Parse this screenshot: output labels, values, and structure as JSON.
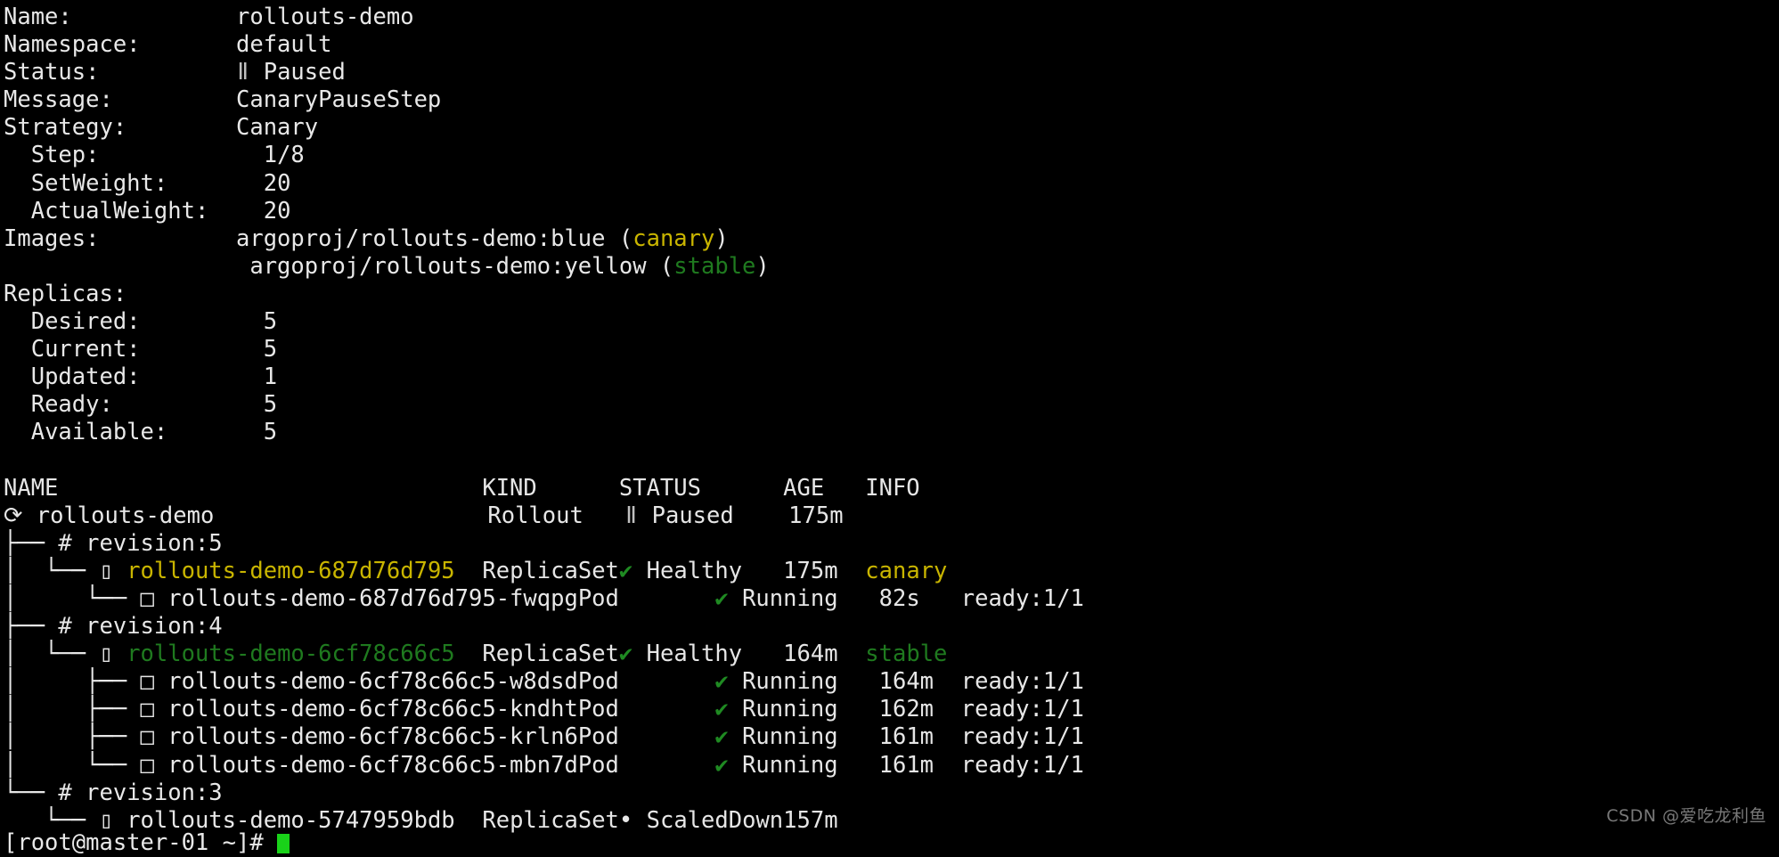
{
  "terminal": {
    "background": "#000000",
    "foreground": "#e8e8e8",
    "accent_yellow": "#c9b500",
    "accent_green": "#1f7a1f",
    "check_green": "#1f8a22",
    "cursor_color": "#19d219"
  },
  "summary": {
    "name_label": "Name:",
    "name_value": "rollouts-demo",
    "namespace_label": "Namespace:",
    "namespace_value": "default",
    "status_label": "Status:",
    "status_icon": "pause-icon",
    "status_icon_glyph": "ǁ",
    "status_value": "Paused",
    "message_label": "Message:",
    "message_value": "CanaryPauseStep",
    "strategy_label": "Strategy:",
    "strategy_value": "Canary",
    "step_label": "Step:",
    "step_value": "1/8",
    "setweight_label": "SetWeight:",
    "setweight_value": "20",
    "actualweight_label": "ActualWeight:",
    "actualweight_value": "20",
    "images_label": "Images:",
    "images": [
      {
        "image": "argoproj/rollouts-demo:blue",
        "tag": "canary",
        "tag_color": "#c9b500"
      },
      {
        "image": "argoproj/rollouts-demo:yellow",
        "tag": "stable",
        "tag_color": "#1f7a1f"
      }
    ],
    "replicas_label": "Replicas:",
    "replicas": [
      {
        "label": "Desired:",
        "value": "5"
      },
      {
        "label": "Current:",
        "value": "5"
      },
      {
        "label": "Updated:",
        "value": "1"
      },
      {
        "label": "Ready:",
        "value": "5"
      },
      {
        "label": "Available:",
        "value": "5"
      }
    ]
  },
  "table": {
    "headers": {
      "name": "NAME",
      "kind": "KIND",
      "status": "STATUS",
      "age": "AGE",
      "info": "INFO"
    },
    "rows": [
      {
        "tree": "",
        "icon": "rollout-icon",
        "icon_glyph": "⟳",
        "name": "rollouts-demo",
        "name_color": "#e8e8e8",
        "kind": "Rollout",
        "status_icon": "pause-icon",
        "status_icon_glyph": "ǁ",
        "status_icon_color": "#bfbfbf",
        "status": "Paused",
        "age": "175m",
        "info": "",
        "info_color": "#e8e8e8"
      },
      {
        "tree": "├──",
        "icon": "revision-icon",
        "icon_glyph": "#",
        "name": "revision:5",
        "name_color": "#e8e8e8",
        "kind": "",
        "status_icon": "",
        "status_icon_glyph": "",
        "status_icon_color": "",
        "status": "",
        "age": "",
        "info": "",
        "info_color": ""
      },
      {
        "tree": "│  └──",
        "icon": "replicaset-icon",
        "icon_glyph": "▯",
        "name": "rollouts-demo-687d76d795",
        "name_color": "#c9b500",
        "kind": "ReplicaSet",
        "status_icon": "check-icon",
        "status_icon_glyph": "✔",
        "status_icon_color": "#1f8a22",
        "status": "Healthy",
        "age": "175m",
        "info": "canary",
        "info_color": "#c9b500"
      },
      {
        "tree": "│     └──",
        "icon": "pod-icon",
        "icon_glyph": "□",
        "name": "rollouts-demo-687d76d795-fwqpg",
        "name_color": "#e8e8e8",
        "kind": "Pod",
        "status_icon": "check-icon",
        "status_icon_glyph": "✔",
        "status_icon_color": "#1f8a22",
        "status": "Running",
        "age": "82s",
        "info": "ready:1/1",
        "info_color": "#e8e8e8"
      },
      {
        "tree": "├──",
        "icon": "revision-icon",
        "icon_glyph": "#",
        "name": "revision:4",
        "name_color": "#e8e8e8",
        "kind": "",
        "status_icon": "",
        "status_icon_glyph": "",
        "status_icon_color": "",
        "status": "",
        "age": "",
        "info": "",
        "info_color": ""
      },
      {
        "tree": "│  └──",
        "icon": "replicaset-icon",
        "icon_glyph": "▯",
        "name": "rollouts-demo-6cf78c66c5",
        "name_color": "#1f7a1f",
        "kind": "ReplicaSet",
        "status_icon": "check-icon",
        "status_icon_glyph": "✔",
        "status_icon_color": "#1f8a22",
        "status": "Healthy",
        "age": "164m",
        "info": "stable",
        "info_color": "#1f7a1f"
      },
      {
        "tree": "│     ├──",
        "icon": "pod-icon",
        "icon_glyph": "□",
        "name": "rollouts-demo-6cf78c66c5-w8dsd",
        "name_color": "#e8e8e8",
        "kind": "Pod",
        "status_icon": "check-icon",
        "status_icon_glyph": "✔",
        "status_icon_color": "#1f8a22",
        "status": "Running",
        "age": "164m",
        "info": "ready:1/1",
        "info_color": "#e8e8e8"
      },
      {
        "tree": "│     ├──",
        "icon": "pod-icon",
        "icon_glyph": "□",
        "name": "rollouts-demo-6cf78c66c5-kndht",
        "name_color": "#e8e8e8",
        "kind": "Pod",
        "status_icon": "check-icon",
        "status_icon_glyph": "✔",
        "status_icon_color": "#1f8a22",
        "status": "Running",
        "age": "162m",
        "info": "ready:1/1",
        "info_color": "#e8e8e8"
      },
      {
        "tree": "│     ├──",
        "icon": "pod-icon",
        "icon_glyph": "□",
        "name": "rollouts-demo-6cf78c66c5-krln6",
        "name_color": "#e8e8e8",
        "kind": "Pod",
        "status_icon": "check-icon",
        "status_icon_glyph": "✔",
        "status_icon_color": "#1f8a22",
        "status": "Running",
        "age": "161m",
        "info": "ready:1/1",
        "info_color": "#e8e8e8"
      },
      {
        "tree": "│     └──",
        "icon": "pod-icon",
        "icon_glyph": "□",
        "name": "rollouts-demo-6cf78c66c5-mbn7d",
        "name_color": "#e8e8e8",
        "kind": "Pod",
        "status_icon": "check-icon",
        "status_icon_glyph": "✔",
        "status_icon_color": "#1f8a22",
        "status": "Running",
        "age": "161m",
        "info": "ready:1/1",
        "info_color": "#e8e8e8"
      },
      {
        "tree": "└──",
        "icon": "revision-icon",
        "icon_glyph": "#",
        "name": "revision:3",
        "name_color": "#e8e8e8",
        "kind": "",
        "status_icon": "",
        "status_icon_glyph": "",
        "status_icon_color": "",
        "status": "",
        "age": "",
        "info": "",
        "info_color": ""
      },
      {
        "tree": "   └──",
        "icon": "replicaset-icon",
        "icon_glyph": "▯",
        "name": "rollouts-demo-5747959bdb",
        "name_color": "#e8e8e8",
        "kind": "ReplicaSet",
        "status_icon": "dot-icon",
        "status_icon_glyph": "•",
        "status_icon_color": "#e8e8e8",
        "status": "ScaledDown",
        "age": "157m",
        "info": "",
        "info_color": "#e8e8e8"
      }
    ]
  },
  "prompt": {
    "text": "[root@master-01 ~]#"
  },
  "watermark": {
    "text": "CSDN @爱吃龙利鱼"
  }
}
